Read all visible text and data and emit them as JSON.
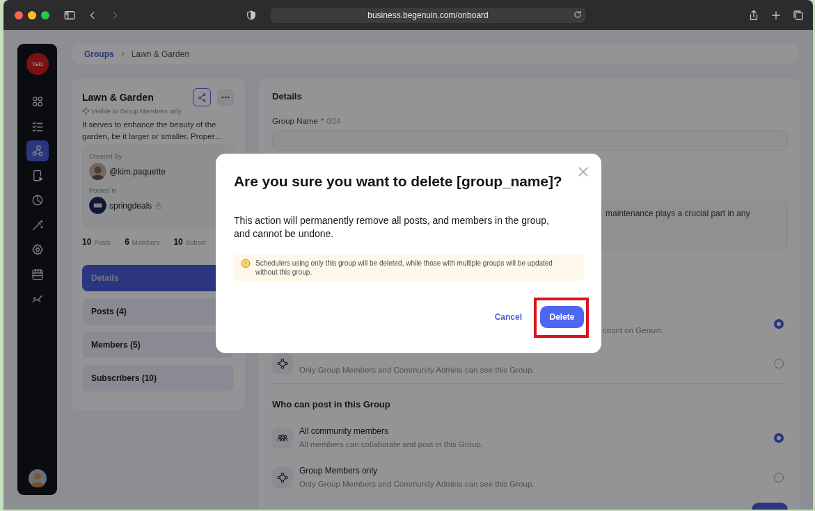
{
  "browser": {
    "url": "business.begenuin.com/onboard"
  },
  "rail": {
    "logo": "TED",
    "items": [
      {
        "kind": "grid",
        "selected": false
      },
      {
        "kind": "checklist",
        "selected": false
      },
      {
        "kind": "network",
        "selected": true
      },
      {
        "kind": "phone-play",
        "selected": false
      },
      {
        "kind": "pie",
        "selected": false
      },
      {
        "kind": "wand",
        "selected": false
      },
      {
        "kind": "gear",
        "selected": false
      },
      {
        "kind": "store",
        "selected": false
      },
      {
        "kind": "trend",
        "selected": false
      }
    ]
  },
  "breadcrumb": [
    {
      "label": "Groups",
      "kind": "link"
    },
    {
      "label": "Lawn & Garden",
      "kind": "current"
    }
  ],
  "group": {
    "name": "Lawn & Garden",
    "visibility": "Visible to Group Members only",
    "description": "It serves to enhance the beauty of the garden, be it larger or smaller. Proper…",
    "created_by_label": "Created By",
    "creator": "@kim.paquette",
    "posted_in_label": "Posted in",
    "community": "springdeals",
    "community_locked": true,
    "stats": [
      {
        "count": "10",
        "label": "Posts"
      },
      {
        "count": "6",
        "label": "Members"
      },
      {
        "count": "10",
        "label": "Subscr"
      }
    ]
  },
  "tabs": [
    {
      "label": "Details",
      "selected": true
    },
    {
      "label": "Posts (4)",
      "selected": false
    },
    {
      "label": "Members (5)",
      "selected": false
    },
    {
      "label": "Subscribers (10)",
      "selected": false
    }
  ],
  "details": {
    "title": "Details",
    "group_name_label": "Group Name",
    "required_mark": "*",
    "counter": "0/24",
    "description_fragment": "maintenance plays a crucial part in any",
    "visibility_options": [
      {
        "description": "count on Genuin.",
        "selected": true
      },
      {
        "kind": "members",
        "description": "Only Group Members and Community Admins can see this Group.",
        "selected": false
      }
    ],
    "post_section_title": "Who can post in this Group",
    "post_options": [
      {
        "kind": "community",
        "title": "All community members",
        "description": "All members can collaborate and post in this Group.",
        "selected": true
      },
      {
        "kind": "members",
        "title": "Group Members only",
        "description": "Only Group Members and Community Admins can see this Group.",
        "selected": false
      }
    ]
  },
  "dialog": {
    "title": "Are you sure you want to delete [group_name]?",
    "message": "This action will permanently remove all posts, and members in the group, and cannot be undone.",
    "warning": "Schedulers using only this group will be deleted, while those with multiple groups will be updated without this group.",
    "buttons": [
      {
        "label": "Cancel",
        "kind": "text",
        "highlighted": false
      },
      {
        "label": "Delete",
        "kind": "primary",
        "highlighted": true
      }
    ]
  }
}
